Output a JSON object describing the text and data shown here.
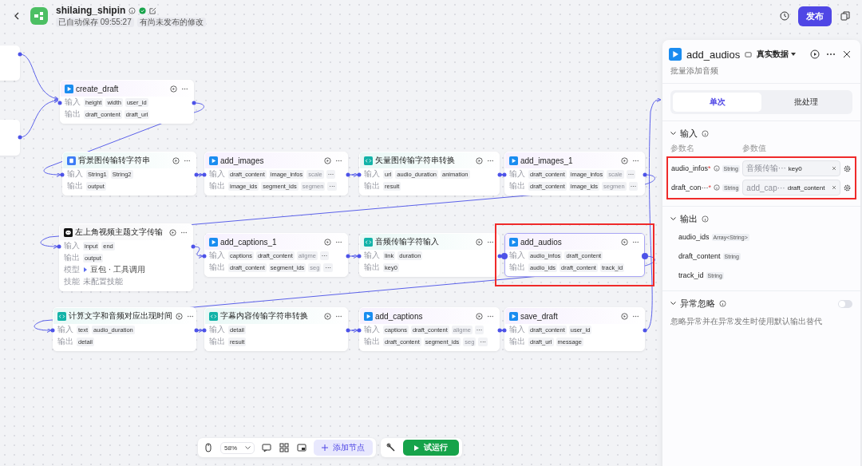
{
  "header": {
    "title": "shilaing_shipin",
    "saved": "已自动保存 09:55:27",
    "status": "有尚未发布的修改",
    "publish": "发布"
  },
  "nodes": [
    {
      "title": "create_draft",
      "kind": "plugin",
      "selected": false,
      "highlighted": false,
      "rows": [
        {
          "label": "输入",
          "kind": "ports",
          "chips": [
            {
              "name": "height",
              "faded": false
            },
            {
              "name": "width",
              "faded": false
            },
            {
              "name": "user_id",
              "faded": false
            }
          ]
        },
        {
          "label": "输出",
          "kind": "ports",
          "chips": [
            {
              "name": "draft_content",
              "faded": false
            },
            {
              "name": "draft_url",
              "faded": false
            }
          ]
        }
      ]
    },
    {
      "title": "背景图传输转字符串",
      "kind": "converter",
      "selected": false,
      "highlighted": false,
      "rows": [
        {
          "label": "输入",
          "kind": "ports",
          "chips": [
            {
              "name": "String1",
              "faded": false
            },
            {
              "name": "String2",
              "faded": false
            }
          ]
        },
        {
          "label": "输出",
          "kind": "ports",
          "chips": [
            {
              "name": "output",
              "faded": false
            }
          ]
        }
      ]
    },
    {
      "title": "add_images",
      "kind": "plugin",
      "selected": false,
      "highlighted": false,
      "rows": [
        {
          "label": "输入",
          "kind": "ports",
          "more": "···",
          "chips": [
            {
              "name": "draft_content",
              "faded": false
            },
            {
              "name": "image_infos",
              "faded": false
            },
            {
              "name": "scale",
              "faded": true
            }
          ]
        },
        {
          "label": "输出",
          "kind": "ports",
          "more": "···",
          "chips": [
            {
              "name": "image_ids",
              "faded": false
            },
            {
              "name": "segment_ids",
              "faded": false
            },
            {
              "name": "segmen",
              "faded": true
            }
          ]
        }
      ]
    },
    {
      "title": "矢量图传输字符串转换",
      "kind": "code",
      "selected": false,
      "highlighted": false,
      "rows": [
        {
          "label": "输入",
          "kind": "ports",
          "chips": [
            {
              "name": "url",
              "faded": false
            },
            {
              "name": "audio_duration",
              "faded": false
            },
            {
              "name": "animation",
              "faded": false
            }
          ]
        },
        {
          "label": "输出",
          "kind": "ports",
          "chips": [
            {
              "name": "result",
              "faded": false
            }
          ]
        }
      ]
    },
    {
      "title": "add_images_1",
      "kind": "plugin",
      "selected": false,
      "highlighted": false,
      "rows": [
        {
          "label": "输入",
          "kind": "ports",
          "more": "···",
          "chips": [
            {
              "name": "draft_content",
              "faded": false
            },
            {
              "name": "image_infos",
              "faded": false
            },
            {
              "name": "scale",
              "faded": true
            }
          ]
        },
        {
          "label": "输出",
          "kind": "ports",
          "more": "···",
          "chips": [
            {
              "name": "draft_content",
              "faded": false
            },
            {
              "name": "image_ids",
              "faded": false
            },
            {
              "name": "segmen",
              "faded": true
            }
          ]
        }
      ]
    },
    {
      "title": "左上角视频主题文字传输",
      "kind": "llm",
      "selected": false,
      "highlighted": false,
      "rows": [
        {
          "label": "输入",
          "kind": "ports",
          "chips": [
            {
              "name": "input",
              "faded": false
            },
            {
              "name": "end",
              "faded": false
            }
          ]
        },
        {
          "label": "输出",
          "kind": "ports",
          "chips": [
            {
              "name": "output",
              "faded": false
            }
          ]
        },
        {
          "label": "模型",
          "kind": "model",
          "value": "豆包 · 工具调用"
        },
        {
          "label": "技能",
          "kind": "text",
          "value": "未配置技能"
        }
      ]
    },
    {
      "title": "add_captions_1",
      "kind": "plugin",
      "selected": false,
      "highlighted": false,
      "rows": [
        {
          "label": "输入",
          "kind": "ports",
          "more": "···",
          "chips": [
            {
              "name": "captions",
              "faded": false
            },
            {
              "name": "draft_content",
              "faded": false
            },
            {
              "name": "aligme",
              "faded": true
            }
          ]
        },
        {
          "label": "输出",
          "kind": "ports",
          "more": "···",
          "chips": [
            {
              "name": "draft_content",
              "faded": false
            },
            {
              "name": "segment_ids",
              "faded": false
            },
            {
              "name": "seg",
              "faded": true
            }
          ]
        }
      ]
    },
    {
      "title": "音频传输字符输入",
      "kind": "code",
      "selected": false,
      "highlighted": false,
      "rows": [
        {
          "label": "输入",
          "kind": "ports",
          "chips": [
            {
              "name": "link",
              "faded": false
            },
            {
              "name": "duration",
              "faded": false
            }
          ]
        },
        {
          "label": "输出",
          "kind": "ports",
          "chips": [
            {
              "name": "key0",
              "faded": false
            }
          ]
        }
      ]
    },
    {
      "title": "add_audios",
      "kind": "plugin",
      "selected": true,
      "highlighted": true,
      "rows": [
        {
          "label": "输入",
          "kind": "ports",
          "chips": [
            {
              "name": "audio_infos",
              "faded": false
            },
            {
              "name": "draft_content",
              "faded": false
            }
          ]
        },
        {
          "label": "输出",
          "kind": "ports",
          "chips": [
            {
              "name": "audio_ids",
              "faded": false
            },
            {
              "name": "draft_content",
              "faded": false
            },
            {
              "name": "track_id",
              "faded": false
            }
          ]
        }
      ]
    },
    {
      "title": "计算文字和音频对应出现时间",
      "kind": "code",
      "selected": false,
      "highlighted": false,
      "rows": [
        {
          "label": "输入",
          "kind": "ports",
          "chips": [
            {
              "name": "text",
              "faded": false
            },
            {
              "name": "audio_duration",
              "faded": false
            }
          ]
        },
        {
          "label": "输出",
          "kind": "ports",
          "chips": [
            {
              "name": "detail",
              "faded": false
            }
          ]
        }
      ]
    },
    {
      "title": "字幕内容传输字符串转换",
      "kind": "code",
      "selected": false,
      "highlighted": false,
      "rows": [
        {
          "label": "输入",
          "kind": "ports",
          "chips": [
            {
              "name": "detail",
              "faded": false
            }
          ]
        },
        {
          "label": "输出",
          "kind": "ports",
          "chips": [
            {
              "name": "result",
              "faded": false
            }
          ]
        }
      ]
    },
    {
      "title": "add_captions",
      "kind": "plugin",
      "selected": false,
      "highlighted": false,
      "rows": [
        {
          "label": "输入",
          "kind": "ports",
          "more": "···",
          "chips": [
            {
              "name": "captions",
              "faded": false
            },
            {
              "name": "draft_content",
              "faded": false
            },
            {
              "name": "aligme",
              "faded": true
            }
          ]
        },
        {
          "label": "输出",
          "kind": "ports",
          "more": "···",
          "chips": [
            {
              "name": "draft_content",
              "faded": false
            },
            {
              "name": "segment_ids",
              "faded": false
            },
            {
              "name": "seg",
              "faded": true
            }
          ]
        }
      ]
    },
    {
      "title": "save_draft",
      "kind": "plugin",
      "selected": false,
      "highlighted": false,
      "rows": [
        {
          "label": "输入",
          "kind": "ports",
          "chips": [
            {
              "name": "draft_content",
              "faded": false
            },
            {
              "name": "user_id",
              "faded": false
            }
          ]
        },
        {
          "label": "输出",
          "kind": "ports",
          "chips": [
            {
              "name": "draft_url",
              "faded": false
            },
            {
              "name": "message",
              "faded": false
            }
          ]
        }
      ]
    }
  ],
  "panel": {
    "title": "add_audios",
    "data_source": "真实数据",
    "description": "批量添加音频",
    "tabs": [
      {
        "label": "单次",
        "selected": true
      },
      {
        "label": "批处理",
        "selected": false
      }
    ],
    "input_section": {
      "title": "输入",
      "column_headers": [
        "参数名",
        "参数值"
      ],
      "highlighted": true,
      "params": [
        {
          "name": "audio_infos",
          "required_mark": "*",
          "type": "String",
          "source": "音频传输···",
          "value": "key0"
        },
        {
          "name": "draft_con···",
          "required_mark": "*",
          "type": "String",
          "source": "add_cap···",
          "value": "draft_content"
        }
      ]
    },
    "output_section": {
      "title": "输出",
      "fields": [
        {
          "name": "audio_ids",
          "type": "Array<String>"
        },
        {
          "name": "draft_content",
          "type": "String"
        },
        {
          "name": "track_id",
          "type": "String"
        }
      ]
    },
    "error_section": {
      "title": "异常忽略",
      "on": false,
      "description": "忽略异常并在异常发生时使用默认输出替代"
    }
  },
  "toolbar": {
    "zoom": "58%",
    "add_node": "添加节点",
    "run": "试运行"
  }
}
